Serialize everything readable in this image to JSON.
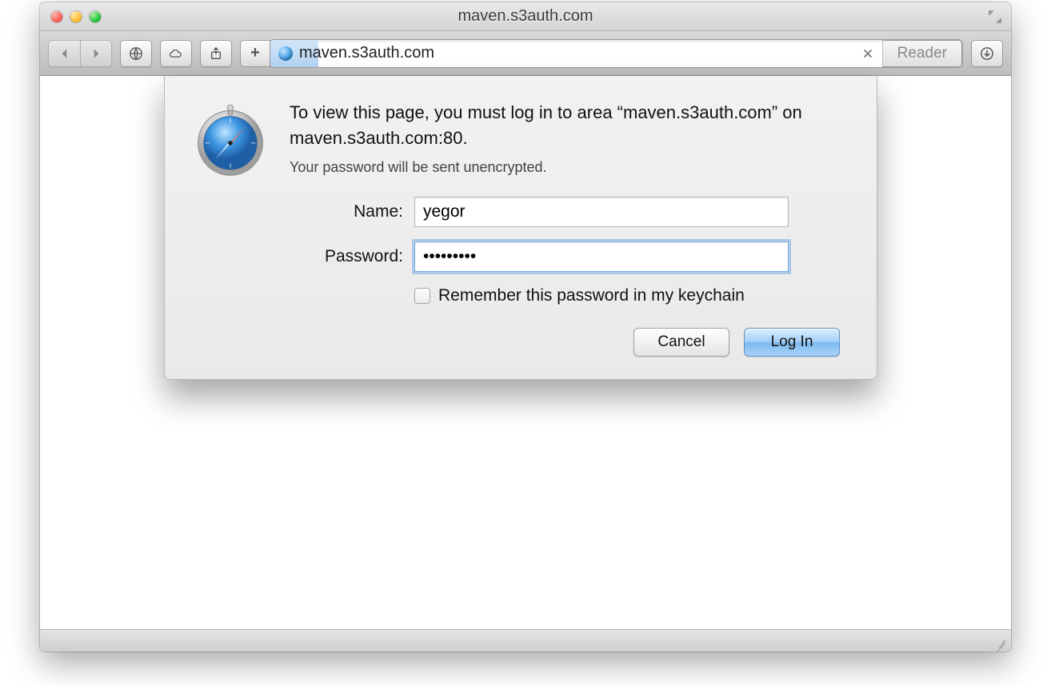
{
  "window": {
    "title": "maven.s3auth.com"
  },
  "toolbar": {
    "url": "maven.s3auth.com",
    "reader_label": "Reader"
  },
  "dialog": {
    "message": "To view this page, you must log in to area “maven.s3auth.com” on maven.s3auth.com:80.",
    "warning": "Your password will be sent unencrypted.",
    "name_label": "Name:",
    "name_value": "yegor",
    "password_label": "Password:",
    "password_value": "•••••••••",
    "remember_label": "Remember this password in my keychain",
    "remember_checked": false,
    "cancel_label": "Cancel",
    "login_label": "Log In"
  }
}
